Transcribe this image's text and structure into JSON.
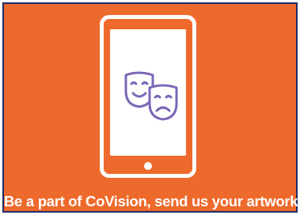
{
  "banner": {
    "background_color": "#ee6a2c",
    "border_color": "#1f2c6b",
    "caption": "Be a part of CoVision, send us your artwork."
  },
  "illustration": {
    "device": "smartphone",
    "screen_icon": "theater-masks-icon",
    "icon_color": "#7b66b7"
  }
}
